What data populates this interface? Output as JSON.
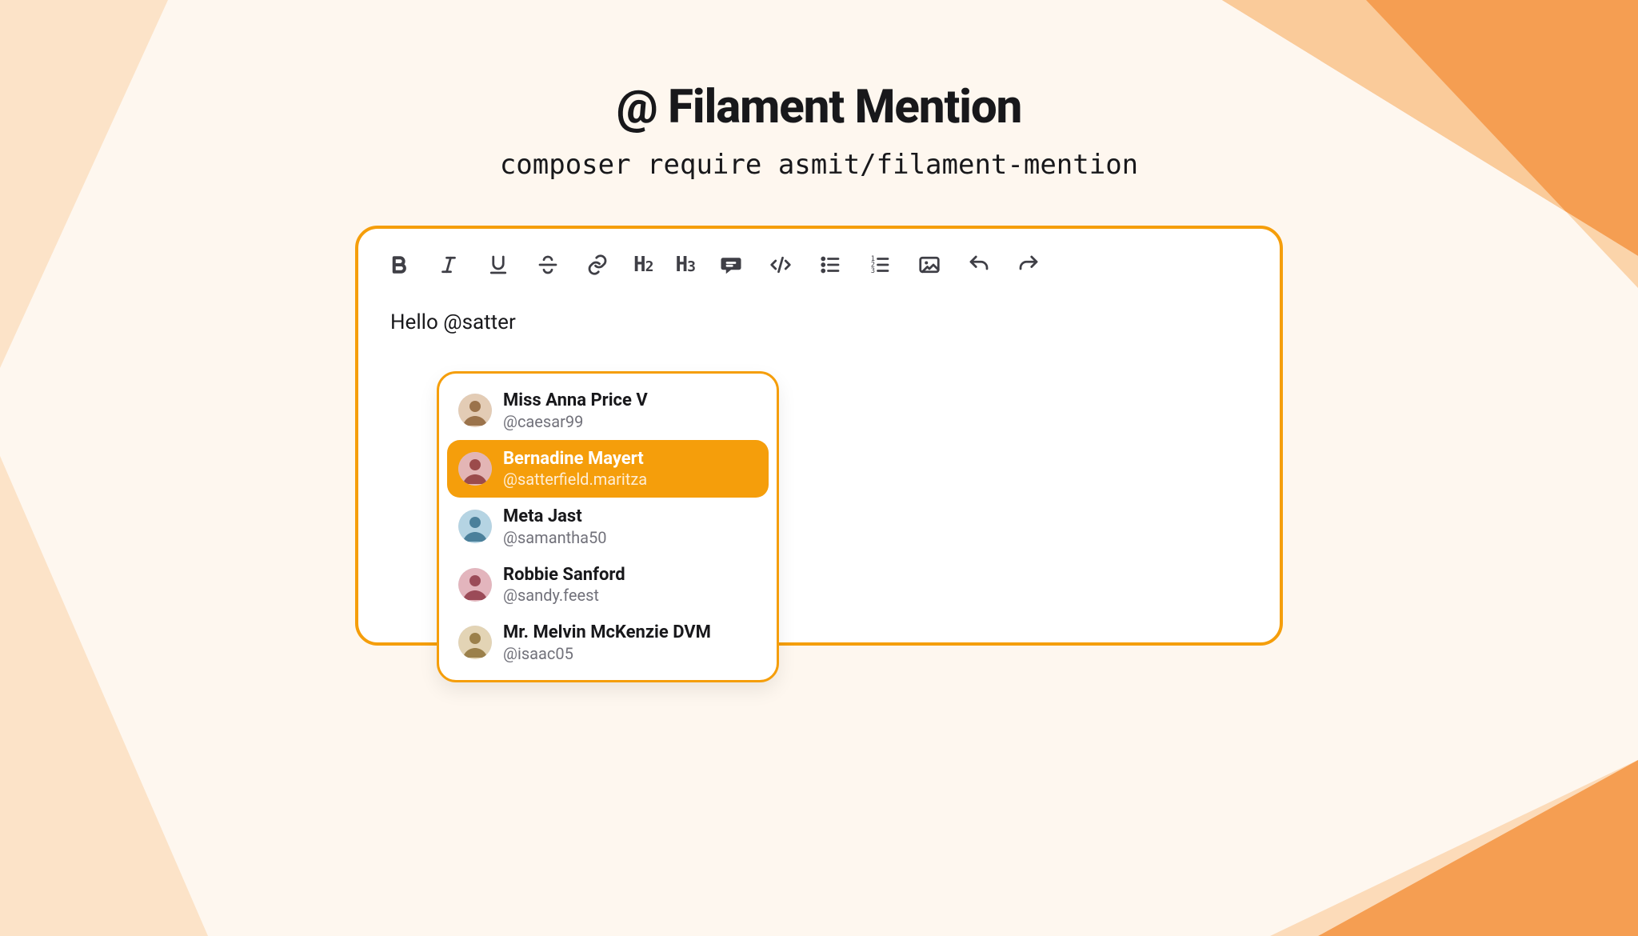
{
  "colors": {
    "accent": "#f59e0b",
    "bg": "#fef7ef",
    "text": "#18181b",
    "muted": "#71717a"
  },
  "header": {
    "title": "@ Filament Mention",
    "subtitle": "composer require asmit/filament-mention"
  },
  "editor": {
    "content": "Hello @satter"
  },
  "toolbar": {
    "bold": "B",
    "italic": "I",
    "underline": "U",
    "strike": "S",
    "link": "Link",
    "h2": "H2",
    "h3": "H3",
    "comment": "Comment",
    "code": "Code",
    "ul": "Bulleted list",
    "ol": "Numbered list",
    "image": "Image",
    "undo": "Undo",
    "redo": "Redo"
  },
  "mentions": {
    "selected_index": 1,
    "items": [
      {
        "name": "Miss Anna Price V",
        "handle": "@caesar99",
        "avatar_hue": 30
      },
      {
        "name": "Bernadine Mayert",
        "handle": "@satterfield.maritza",
        "avatar_hue": 0
      },
      {
        "name": "Meta Jast",
        "handle": "@samantha50",
        "avatar_hue": 200
      },
      {
        "name": "Robbie Sanford",
        "handle": "@sandy.feest",
        "avatar_hue": 350
      },
      {
        "name": "Mr. Melvin McKenzie DVM",
        "handle": "@isaac05",
        "avatar_hue": 40
      }
    ]
  }
}
